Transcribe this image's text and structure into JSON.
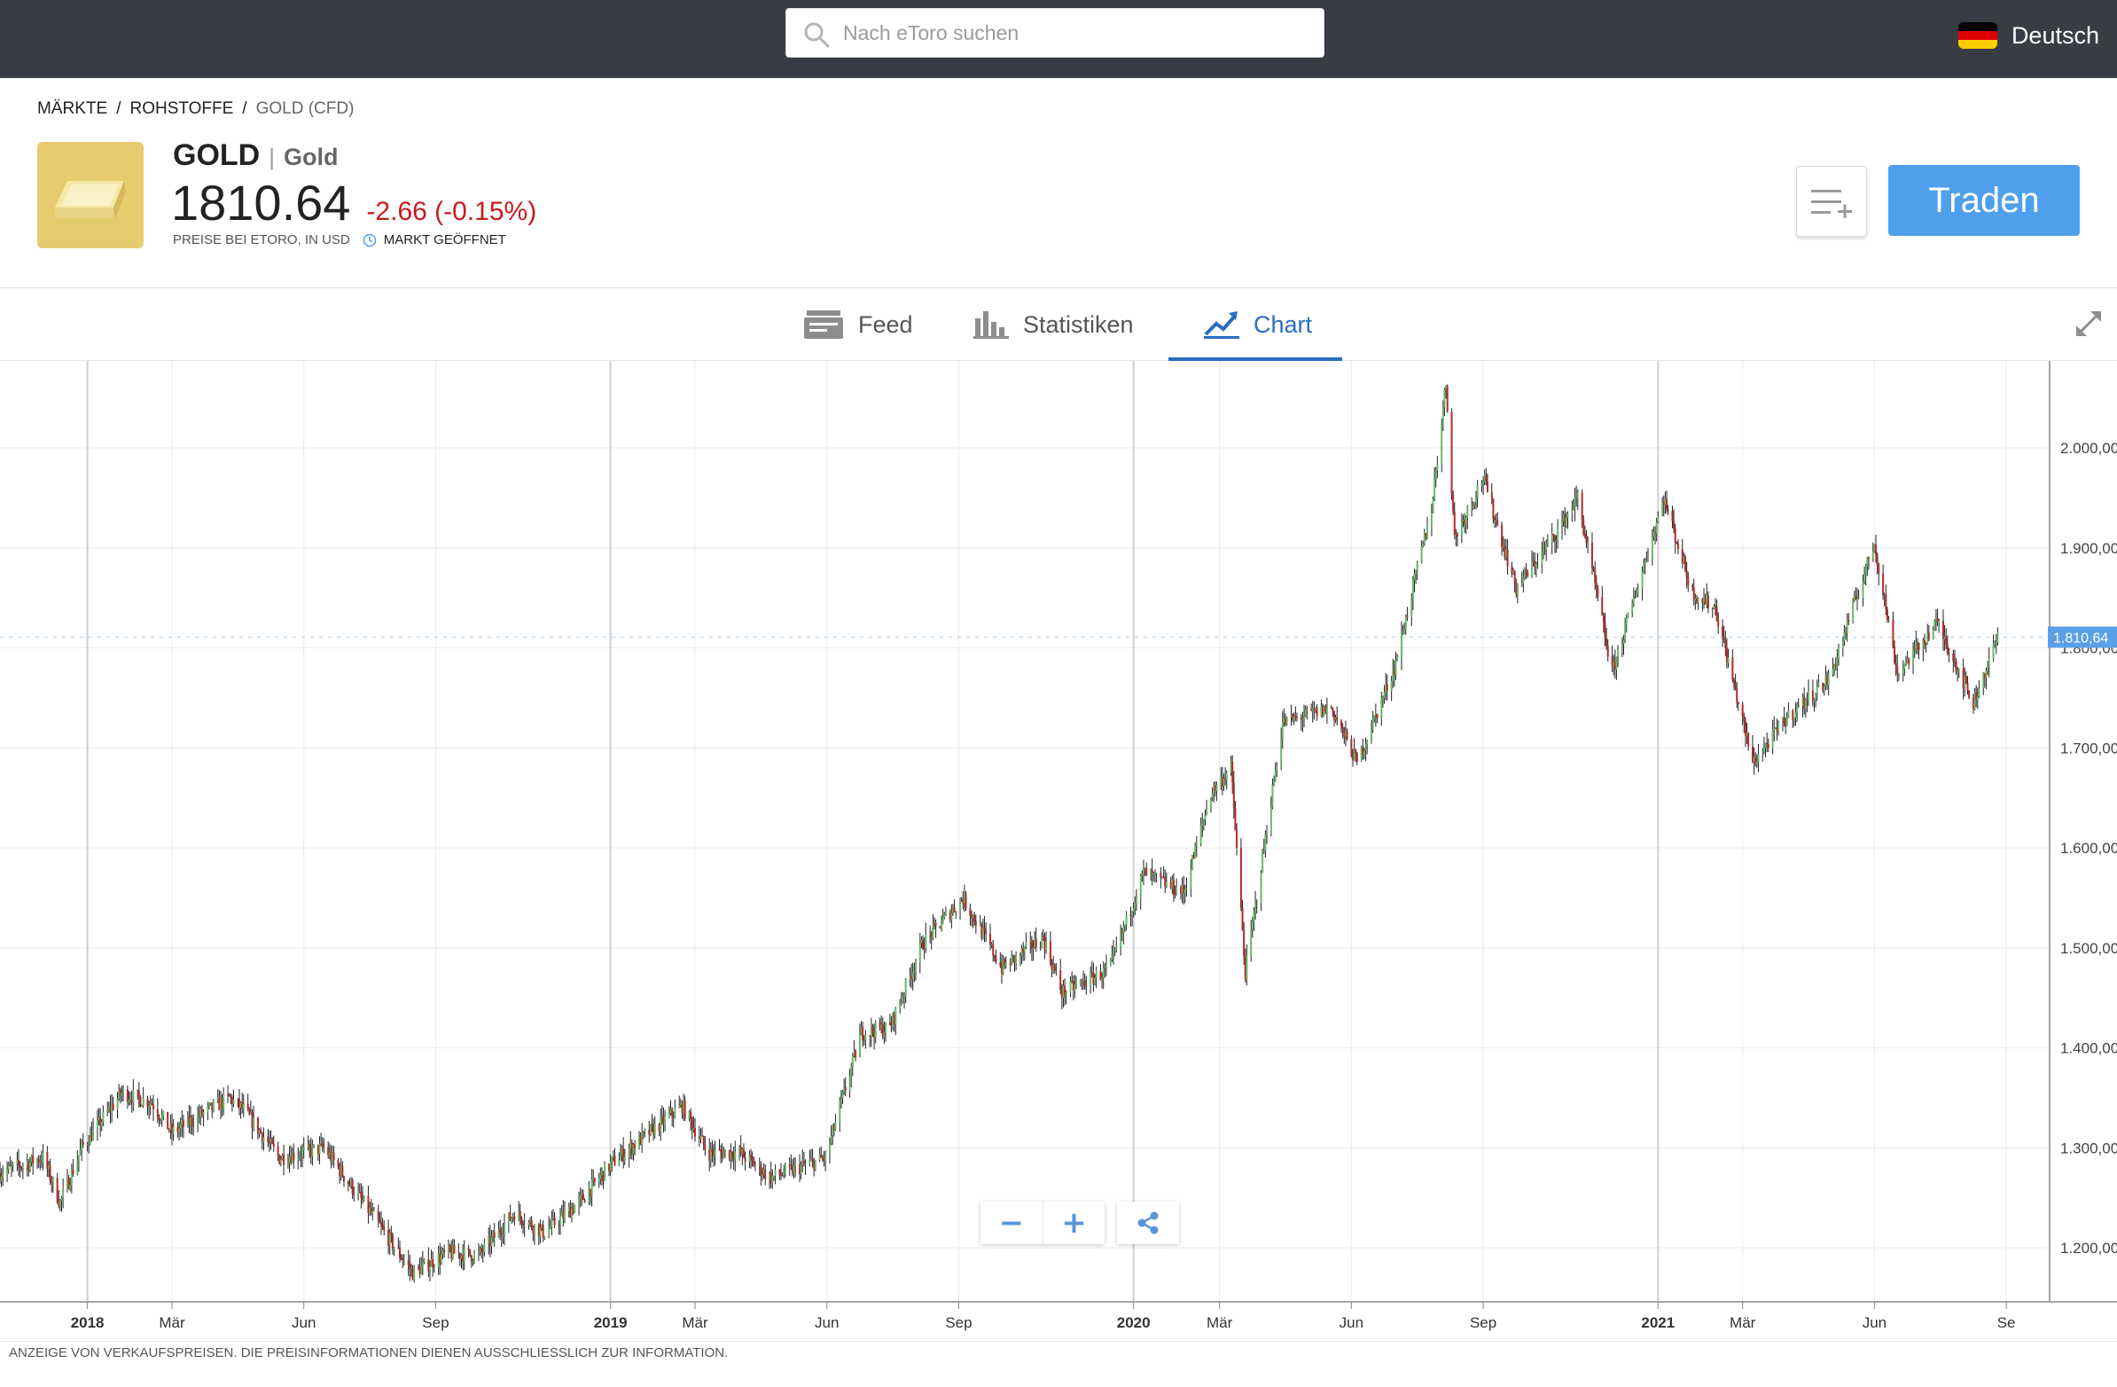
{
  "topbar": {
    "search_placeholder": "Nach eToro suchen",
    "search_icon": "search-icon",
    "language": "Deutsch",
    "flag_icon": "germany-flag-icon",
    "flag_colors": [
      "#000000",
      "#dd0000",
      "#ffce00"
    ]
  },
  "breadcrumb": {
    "items": [
      "MÄRKTE",
      "ROHSTOFFE",
      "GOLD (CFD)"
    ],
    "separator": "/"
  },
  "asset": {
    "symbol": "GOLD",
    "separator": "|",
    "name": "Gold",
    "price": "1810.64",
    "change": "-2.66 (-0.15%)",
    "price_note": "PREISE BEI ETORO, IN USD",
    "market_status": "MARKT GEÖFFNET",
    "logo_icon": "gold-bar-icon"
  },
  "actions": {
    "watchlist_icon": "add-to-watchlist-icon",
    "trade_label": "Traden"
  },
  "tabs": [
    {
      "label": "Feed",
      "icon": "feed-icon",
      "active": false
    },
    {
      "label": "Statistiken",
      "icon": "bar-chart-icon",
      "active": false
    },
    {
      "label": "Chart",
      "icon": "trend-chart-icon",
      "active": true
    }
  ],
  "colors": {
    "topbar": "#393c45",
    "accent": "#4fa0ec",
    "tab_active": "#2a6cc2",
    "negative": "#c81b1b",
    "candle_up": "#6bb66b",
    "candle_down": "#b22a2a",
    "price_tag": "#5aa0e6"
  },
  "chart_data": {
    "type": "candlestick",
    "current_price_label": "1.810,64",
    "ylim": [
      1150,
      2090
    ],
    "y_ticks": [
      {
        "value": 1200,
        "label": "1.200,00"
      },
      {
        "value": 1300,
        "label": "1.300,00"
      },
      {
        "value": 1400,
        "label": "1.400,00"
      },
      {
        "value": 1500,
        "label": "1.500,00"
      },
      {
        "value": 1600,
        "label": "1.600,00"
      },
      {
        "value": 1700,
        "label": "1.700,00"
      },
      {
        "value": 1800,
        "label": "1.800,00"
      },
      {
        "value": 1900,
        "label": "1.900,00"
      },
      {
        "value": 2000,
        "label": "2.000,00"
      }
    ],
    "x_range": [
      "2017-11-01",
      "2021-09-30"
    ],
    "x_ticks": [
      {
        "date": "2018-01-01",
        "label": "2018",
        "year": true
      },
      {
        "date": "2018-03-01",
        "label": "Mär",
        "year": false
      },
      {
        "date": "2018-06-01",
        "label": "Jun",
        "year": false
      },
      {
        "date": "2018-09-01",
        "label": "Sep",
        "year": false
      },
      {
        "date": "2019-01-01",
        "label": "2019",
        "year": true
      },
      {
        "date": "2019-03-01",
        "label": "Mär",
        "year": false
      },
      {
        "date": "2019-06-01",
        "label": "Jun",
        "year": false
      },
      {
        "date": "2019-09-01",
        "label": "Sep",
        "year": false
      },
      {
        "date": "2020-01-01",
        "label": "2020",
        "year": true
      },
      {
        "date": "2020-03-01",
        "label": "Mär",
        "year": false
      },
      {
        "date": "2020-06-01",
        "label": "Jun",
        "year": false
      },
      {
        "date": "2020-09-01",
        "label": "Sep",
        "year": false
      },
      {
        "date": "2021-01-01",
        "label": "2021",
        "year": true
      },
      {
        "date": "2021-03-01",
        "label": "Mär",
        "year": false
      },
      {
        "date": "2021-06-01",
        "label": "Jun",
        "year": false
      },
      {
        "date": "2021-09-01",
        "label": "Se",
        "year": false
      }
    ],
    "price_path": [
      [
        "2017-11-01",
        1275
      ],
      [
        "2017-12-01",
        1290
      ],
      [
        "2017-12-13",
        1245
      ],
      [
        "2017-12-28",
        1300
      ],
      [
        "2018-01-25",
        1355
      ],
      [
        "2018-02-15",
        1345
      ],
      [
        "2018-03-01",
        1315
      ],
      [
        "2018-04-10",
        1350
      ],
      [
        "2018-04-20",
        1338
      ],
      [
        "2018-05-15",
        1290
      ],
      [
        "2018-06-15",
        1300
      ],
      [
        "2018-07-15",
        1240
      ],
      [
        "2018-08-16",
        1175
      ],
      [
        "2018-09-10",
        1195
      ],
      [
        "2018-10-01",
        1192
      ],
      [
        "2018-10-26",
        1235
      ],
      [
        "2018-11-15",
        1215
      ],
      [
        "2018-12-10",
        1245
      ],
      [
        "2019-01-02",
        1285
      ],
      [
        "2019-02-20",
        1342
      ],
      [
        "2019-03-10",
        1295
      ],
      [
        "2019-04-01",
        1295
      ],
      [
        "2019-04-23",
        1270
      ],
      [
        "2019-05-31",
        1290
      ],
      [
        "2019-06-25",
        1415
      ],
      [
        "2019-07-15",
        1420
      ],
      [
        "2019-08-07",
        1505
      ],
      [
        "2019-09-04",
        1550
      ],
      [
        "2019-10-01",
        1480
      ],
      [
        "2019-10-30",
        1510
      ],
      [
        "2019-11-12",
        1455
      ],
      [
        "2019-12-15",
        1478
      ],
      [
        "2020-01-08",
        1575
      ],
      [
        "2020-02-05",
        1555
      ],
      [
        "2020-02-24",
        1655
      ],
      [
        "2020-03-09",
        1680
      ],
      [
        "2020-03-19",
        1475
      ],
      [
        "2020-04-14",
        1725
      ],
      [
        "2020-05-18",
        1740
      ],
      [
        "2020-06-05",
        1685
      ],
      [
        "2020-07-01",
        1780
      ],
      [
        "2020-07-27",
        1940
      ],
      [
        "2020-08-06",
        2065
      ],
      [
        "2020-08-12",
        1910
      ],
      [
        "2020-09-01",
        1970
      ],
      [
        "2020-09-24",
        1860
      ],
      [
        "2020-10-20",
        1910
      ],
      [
        "2020-11-06",
        1950
      ],
      [
        "2020-11-30",
        1775
      ],
      [
        "2021-01-05",
        1950
      ],
      [
        "2021-01-25",
        1855
      ],
      [
        "2021-02-10",
        1840
      ],
      [
        "2021-03-08",
        1685
      ],
      [
        "2021-04-01",
        1730
      ],
      [
        "2021-05-01",
        1770
      ],
      [
        "2021-06-01",
        1905
      ],
      [
        "2021-06-17",
        1775
      ],
      [
        "2021-07-15",
        1825
      ],
      [
        "2021-08-09",
        1745
      ],
      [
        "2021-08-26",
        1810
      ]
    ]
  },
  "zoom": {
    "minus": "−",
    "plus": "+",
    "share_icon": "share-icon"
  },
  "footer": {
    "disclaimer": "ANZEIGE VON VERKAUFSPREISEN. DIE PREISINFORMATIONEN DIENEN AUSSCHLIESSLICH ZUR INFORMATION."
  }
}
